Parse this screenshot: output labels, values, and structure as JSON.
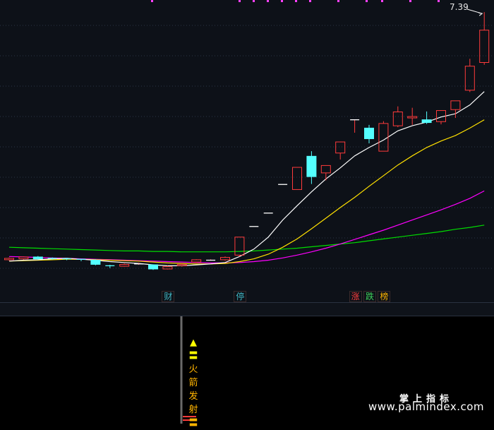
{
  "chart_data": {
    "type": "candlestick",
    "ylim": [
      1.6,
      7.5
    ],
    "grid": true,
    "candles": [
      {
        "o": 2.03,
        "c": 2.06,
        "h": 2.08,
        "l": 2.01
      },
      {
        "o": 2.05,
        "c": 2.09,
        "h": 2.1,
        "l": 2.03
      },
      {
        "o": 2.09,
        "c": 2.05,
        "h": 2.11,
        "l": 2.03
      },
      {
        "o": 2.06,
        "c": 2.05,
        "h": 2.08,
        "l": 2.03
      },
      {
        "o": 2.05,
        "c": 2.04,
        "h": 2.07,
        "l": 2.02
      },
      {
        "o": 2.04,
        "c": 2.03,
        "h": 2.05,
        "l": 2.0
      },
      {
        "o": 2.02,
        "c": 1.93,
        "h": 2.04,
        "l": 1.91
      },
      {
        "o": 1.9,
        "c": 1.89,
        "h": 1.92,
        "l": 1.85
      },
      {
        "o": 1.89,
        "c": 1.93,
        "h": 1.95,
        "l": 1.88
      },
      {
        "o": 1.94,
        "c": 1.94,
        "h": 1.97,
        "l": 1.92
      },
      {
        "o": 1.92,
        "c": 1.83,
        "h": 1.93,
        "l": 1.81
      },
      {
        "o": 1.83,
        "c": 1.88,
        "h": 1.9,
        "l": 1.82
      },
      {
        "o": 1.9,
        "c": 1.93,
        "h": 1.95,
        "l": 1.88
      },
      {
        "o": 1.98,
        "c": 2.03,
        "h": 2.04,
        "l": 1.96
      },
      {
        "o": 2.02,
        "c": 2.02,
        "h": 2.04,
        "l": 2.01
      },
      {
        "o": 2.03,
        "c": 2.08,
        "h": 2.1,
        "l": 2.01
      },
      {
        "o": 2.13,
        "c": 2.52,
        "h": 2.52,
        "l": 2.1
      },
      {
        "o": 2.75,
        "c": 2.75,
        "h": 2.75,
        "l": 2.75
      },
      {
        "o": 3.04,
        "c": 3.04,
        "h": 3.04,
        "l": 3.04
      },
      {
        "o": 3.66,
        "c": 3.66,
        "h": 3.66,
        "l": 3.66
      },
      {
        "o": 3.55,
        "c": 4.03,
        "h": 4.03,
        "l": 3.55
      },
      {
        "o": 4.27,
        "c": 3.83,
        "h": 4.38,
        "l": 3.67
      },
      {
        "o": 3.91,
        "c": 4.07,
        "h": 4.07,
        "l": 3.75
      },
      {
        "o": 4.34,
        "c": 4.58,
        "h": 4.58,
        "l": 4.2
      },
      {
        "o": 5.06,
        "c": 5.06,
        "h": 5.06,
        "l": 4.78
      },
      {
        "o": 4.88,
        "c": 4.65,
        "h": 4.95,
        "l": 4.55
      },
      {
        "o": 4.38,
        "c": 4.98,
        "h": 5.03,
        "l": 4.38
      },
      {
        "o": 4.93,
        "c": 5.23,
        "h": 5.35,
        "l": 4.9
      },
      {
        "o": 5.1,
        "c": 5.13,
        "h": 5.32,
        "l": 4.95
      },
      {
        "o": 5.06,
        "c": 5.0,
        "h": 5.24,
        "l": 4.97
      },
      {
        "o": 5.02,
        "c": 5.26,
        "h": 5.26,
        "l": 4.96
      },
      {
        "o": 5.28,
        "c": 5.47,
        "h": 5.47,
        "l": 5.1
      },
      {
        "o": 5.7,
        "c": 6.22,
        "h": 6.38,
        "l": 5.66
      },
      {
        "o": 6.3,
        "c": 7.0,
        "h": 7.39,
        "l": 6.25
      }
    ],
    "ma5": [
      2.0,
      2.02,
      2.03,
      2.05,
      2.06,
      2.04,
      2.02,
      1.99,
      1.97,
      1.95,
      1.92,
      1.9,
      1.9,
      1.92,
      1.94,
      1.97,
      2.1,
      2.26,
      2.52,
      2.89,
      3.2,
      3.5,
      3.78,
      4.02,
      4.28,
      4.46,
      4.62,
      4.82,
      4.93,
      5.01,
      5.12,
      5.19,
      5.38,
      5.67
    ],
    "ma10": [
      2.0,
      2.01,
      2.02,
      2.03,
      2.04,
      2.04,
      2.03,
      2.02,
      2.01,
      2.0,
      1.98,
      1.96,
      1.95,
      1.94,
      1.94,
      1.95,
      1.99,
      2.05,
      2.15,
      2.3,
      2.48,
      2.7,
      2.93,
      3.16,
      3.38,
      3.62,
      3.85,
      4.08,
      4.28,
      4.46,
      4.6,
      4.72,
      4.88,
      5.06
    ],
    "ma20": [
      2.1,
      2.09,
      2.08,
      2.07,
      2.06,
      2.05,
      2.04,
      2.03,
      2.02,
      2.01,
      2.0,
      1.99,
      1.98,
      1.97,
      1.96,
      1.96,
      1.97,
      1.99,
      2.02,
      2.07,
      2.13,
      2.2,
      2.28,
      2.37,
      2.47,
      2.57,
      2.67,
      2.78,
      2.89,
      3.0,
      3.11,
      3.23,
      3.36,
      3.52
    ],
    "ma60": [
      2.3,
      2.29,
      2.28,
      2.27,
      2.26,
      2.25,
      2.24,
      2.23,
      2.22,
      2.22,
      2.21,
      2.21,
      2.2,
      2.2,
      2.2,
      2.2,
      2.21,
      2.22,
      2.24,
      2.26,
      2.28,
      2.31,
      2.34,
      2.37,
      2.4,
      2.44,
      2.48,
      2.52,
      2.56,
      2.6,
      2.64,
      2.69,
      2.73,
      2.78
    ],
    "high_label": "7.39",
    "events": [
      {
        "text": "财",
        "color": "#41b6c2",
        "index": 11
      },
      {
        "text": "停",
        "color": "#41b6c2",
        "index": 16
      },
      {
        "text": "涨",
        "color": "#ff4040",
        "index": 24
      },
      {
        "text": "跌",
        "color": "#3fd05a",
        "index": 25
      },
      {
        "text": "榜",
        "color": "#ffb400",
        "index": 26
      }
    ]
  },
  "colors": {
    "up": "#ff3b3b",
    "down": "#54ffff",
    "ma5": "#ffffff",
    "ma10": "#ffe000",
    "ma20": "#ff00ff",
    "ma60": "#00dd00",
    "grid": "#2a3546"
  },
  "indicator": {
    "label_lines": [
      "▲",
      "〓",
      "火",
      "箭",
      "发",
      "射",
      "〓"
    ]
  },
  "watermark": {
    "title": "掌上指标",
    "url": "www.palmindex.com"
  }
}
